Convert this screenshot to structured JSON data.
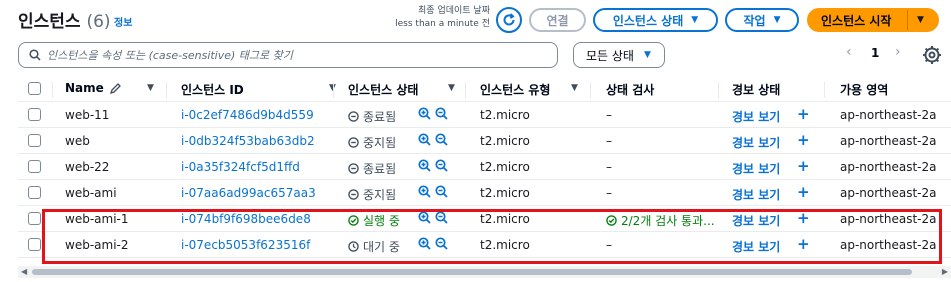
{
  "header": {
    "title": "인스턴스",
    "count": "(6)",
    "info": "정보",
    "last_updated_line1": "최종 업데이트 날짜",
    "last_updated_line2": "less than a minute 전"
  },
  "buttons": {
    "connect": "연결",
    "instance_state": "인스턴스 상태",
    "actions": "작업",
    "launch": "인스턴스 시작"
  },
  "filter": {
    "placeholder": "인스턴스을 속성 또는 (case-sensitive) 태그로 찾기",
    "state_select": "모든 상태"
  },
  "pagination": {
    "page": "1"
  },
  "columns": [
    "Name",
    "인스턴스 ID",
    "인스턴스 상태",
    "인스턴스 유형",
    "상태 검사",
    "경보 상태",
    "가용 영역"
  ],
  "rows": [
    {
      "name": "web-11",
      "id": "i-0c2ef7486d9b4d559",
      "state": "종료됨",
      "state_kind": "stopped",
      "type": "t2.micro",
      "check": "–",
      "alarm": "경보 보기",
      "az": "ap-northeast-2a"
    },
    {
      "name": "web",
      "id": "i-0db324f53bab63db2",
      "state": "중지됨",
      "state_kind": "stopped",
      "type": "t2.micro",
      "check": "–",
      "alarm": "경보 보기",
      "az": "ap-northeast-2a"
    },
    {
      "name": "web-22",
      "id": "i-0a35f324fcf5d1ffd",
      "state": "종료됨",
      "state_kind": "stopped",
      "type": "t2.micro",
      "check": "–",
      "alarm": "경보 보기",
      "az": "ap-northeast-2a"
    },
    {
      "name": "web-ami",
      "id": "i-07aa6ad99ac657aa3",
      "state": "중지됨",
      "state_kind": "stopped",
      "type": "t2.micro",
      "check": "–",
      "alarm": "경보 보기",
      "az": "ap-northeast-2a"
    },
    {
      "name": "web-ami-1",
      "id": "i-074bf9f698bee6de8",
      "state": "실행 중",
      "state_kind": "running",
      "type": "t2.micro",
      "check": "2/2개 검사 통과...",
      "alarm": "경보 보기",
      "az": "ap-northeast-2a"
    },
    {
      "name": "web-ami-2",
      "id": "i-07ecb5053f623516f",
      "state": "대기 중",
      "state_kind": "pending",
      "type": "t2.micro",
      "check": "–",
      "alarm": "경보 보기",
      "az": "ap-northeast-2a"
    }
  ],
  "colors": {
    "link": "#0972d3",
    "primary": "#ff9900",
    "running": "#037f0c",
    "highlight": "#e2131b"
  }
}
